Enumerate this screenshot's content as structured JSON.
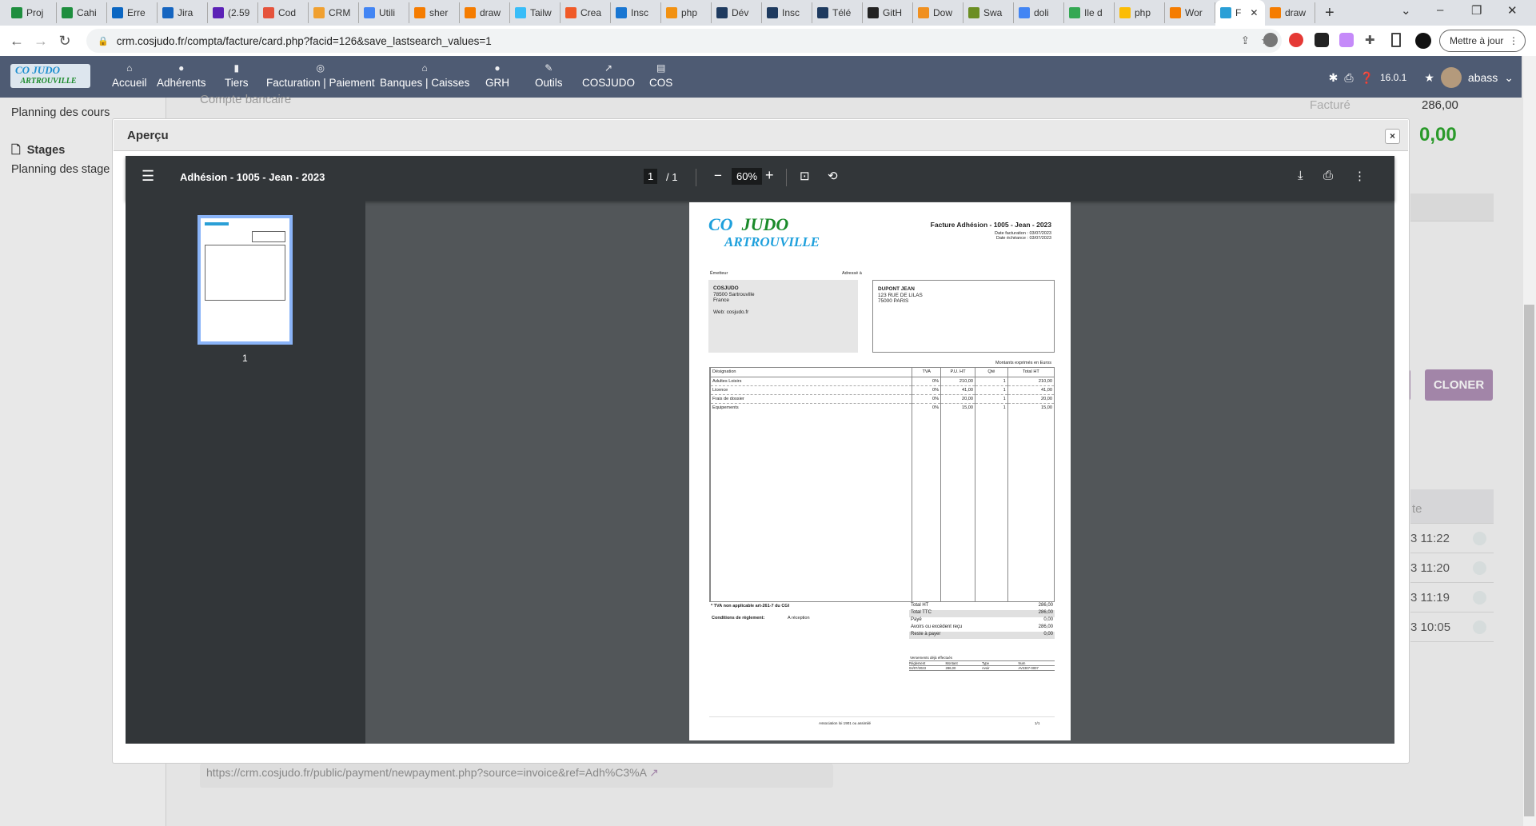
{
  "browser": {
    "tabs": [
      "Proj",
      "Cahi",
      "Erre",
      "Jira",
      "(2.59",
      "Cod",
      "CRM",
      "Utili",
      "sher",
      "draw",
      "Tailw",
      "Crea",
      "Insc",
      "php",
      "Dév",
      "Insc",
      "Télé",
      "GitH",
      "Dow",
      "Swa",
      "doli",
      "Ile d",
      "php",
      "Wor",
      "F",
      "draw"
    ],
    "tab_colors": [
      "#1e8e3e",
      "#1e8e3e",
      "#0b66c2",
      "#1565c0",
      "#5b21b6",
      "#e5533c",
      "#f0a030",
      "#4285f4",
      "#f57c00",
      "#f57c00",
      "#38bdf8",
      "#f05a28",
      "#1976d2",
      "#f29111",
      "#1e3a5f",
      "#1e3a5f",
      "#1e3a5f",
      "#222",
      "#f09020",
      "#6b8e23",
      "#4285f4",
      "#34a853",
      "#fbbc04",
      "#f57c00",
      "#2a9fd6",
      "#f57c00"
    ],
    "new_tab": "+",
    "url": "crm.cosjudo.fr/compta/facture/card.php?facid=126&save_lastsearch_values=1",
    "update_button": "Mettre à jour"
  },
  "nav": {
    "logo_text_top": "CO JUDO",
    "logo_text_bottom": "ARTROUVILLE",
    "items": [
      {
        "label": "Accueil",
        "icon": "⌂"
      },
      {
        "label": "Adhérents",
        "icon": "●"
      },
      {
        "label": "Tiers",
        "icon": "▮"
      },
      {
        "label": "Facturation | Paiement",
        "icon": "◎"
      },
      {
        "label": "Banques | Caisses",
        "icon": "⌂"
      },
      {
        "label": "GRH",
        "icon": "●"
      },
      {
        "label": "Outils",
        "icon": "✎"
      },
      {
        "label": "COSJUDO",
        "icon": "↗"
      },
      {
        "label": "COS",
        "icon": "▤"
      }
    ],
    "version": "16.0.1",
    "user": "abass"
  },
  "background": {
    "sidebar": {
      "planning_cours": "Planning des cours",
      "stages": "Stages",
      "planning_stages": "Planning des stage"
    },
    "compte_bancaire": "Compte bancaire",
    "facture_label": "Facturé",
    "facture_value": "286,00",
    "reste_value": "0,00",
    "events_header": "te",
    "events": [
      "3 11:22",
      "3 11:20",
      "3 11:19",
      "3 10:05"
    ],
    "cloner": "CLONER",
    "payment_url": "https://crm.cosjudo.fr/public/payment/newpayment.php?source=invoice&ref=Adh%C3%A"
  },
  "modal": {
    "title": "Aperçu",
    "close": "×",
    "viewer": {
      "doc_title": "Adhésion - 1005 - Jean - 2023",
      "page_current": "1",
      "page_total": "/ 1",
      "zoom": "60%",
      "thumb_label": "1"
    }
  },
  "invoice": {
    "logo_top": "CO  JUDO",
    "logo_bottom": "ARTROUVILLE",
    "title": "Facture Adhésion - 1005 - Jean - 2023",
    "date_facturation": "Date facturation : 03/07/2023",
    "date_echeance": "Date échéance : 03/07/2023",
    "emetteur_label": "Émetteur",
    "emetteur": {
      "name": "COSJUDO",
      "line1": "78500 Sartrouville",
      "line2": "France",
      "web": "Web: cosjudo.fr"
    },
    "adresse_label": "Adressé à",
    "client": {
      "name": "DUPONT JEAN",
      "line1": "123 RUE DE LILAS",
      "line2": "75000 PARIS"
    },
    "currency_note": "Montants exprimés en Euros",
    "columns": [
      "Désignation",
      "TVA",
      "P.U. HT",
      "Qté",
      "Total HT"
    ],
    "lines": [
      [
        "Adultes Loisirs",
        "0%",
        "210,00",
        "1",
        "210,00"
      ],
      [
        "Licence",
        "0%",
        "41,00",
        "1",
        "41,00"
      ],
      [
        "Frais de dossier",
        "0%",
        "20,00",
        "1",
        "20,00"
      ],
      [
        "Equipements",
        "0%",
        "15,00",
        "1",
        "15,00"
      ]
    ],
    "tva_note": "* TVA non applicable art-261-7 du CGI",
    "conditions_label": "Conditions de règlement:",
    "conditions_value": "A réception",
    "totals": [
      {
        "label": "Total HT",
        "value": "286,00"
      },
      {
        "label": "Total TTC",
        "value": "286,00"
      },
      {
        "label": "Payé",
        "value": "0,00"
      },
      {
        "label": "Avoirs ou excédent reçu",
        "value": "286,00"
      },
      {
        "label": "Reste à payer",
        "value": "0,00"
      }
    ],
    "payments_title": "Versements déjà effectués",
    "payments_columns": [
      "Règlement",
      "Montant",
      "Type",
      "Num"
    ],
    "payments": [
      [
        "04/07/2023",
        "286,00",
        "Avoir",
        "AV2307-0007"
      ]
    ],
    "footer": "Association loi 1901 ou assimilé",
    "page_num": "1/1"
  }
}
